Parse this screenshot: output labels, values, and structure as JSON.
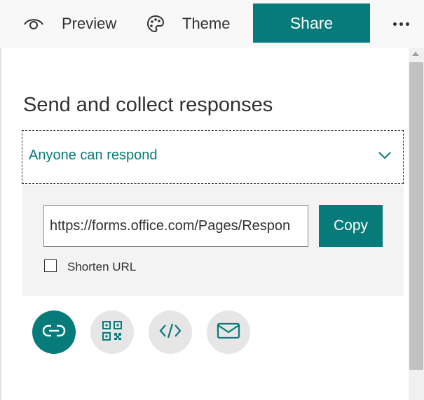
{
  "topbar": {
    "preview_label": "Preview",
    "preview_icon": "eye-icon",
    "theme_label": "Theme",
    "theme_icon": "palette-icon",
    "share_label": "Share",
    "more_icon": "more-options-icon"
  },
  "panel": {
    "title": "Send and collect responses",
    "audience": {
      "selected": "Anyone can respond",
      "icon": "chevron-down-icon"
    },
    "link": {
      "url": "https://forms.office.com/Pages/Respon",
      "copy_label": "Copy",
      "shorten_label": "Shorten URL",
      "shorten_checked": false
    },
    "share_methods": [
      {
        "icon": "link-icon",
        "active": true
      },
      {
        "icon": "qr-code-icon",
        "active": false
      },
      {
        "icon": "embed-code-icon",
        "active": false
      },
      {
        "icon": "email-icon",
        "active": false
      }
    ]
  },
  "colors": {
    "accent": "#077a7a",
    "panel_bg": "#f3f3f3",
    "topbar_bg": "#f8f8f8",
    "inactive_circle": "#e6e6e6"
  }
}
